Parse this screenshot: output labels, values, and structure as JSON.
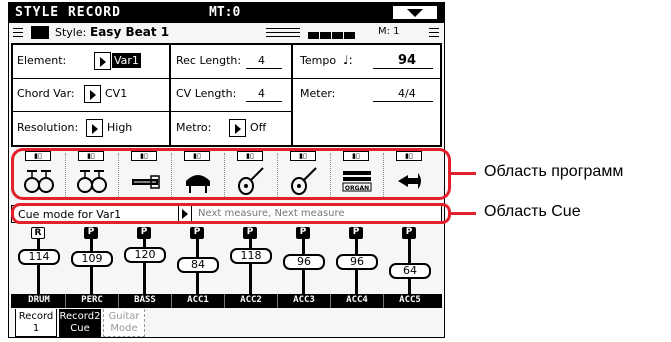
{
  "title": "STYLE RECORD",
  "mt": "MT:0",
  "style_bar": {
    "style_icon": "Style-icon",
    "style_label": "Style:",
    "style_name": "Easy Beat 1",
    "measure": "M: 1"
  },
  "params": {
    "element_label": "Element:",
    "element_value": "Var1",
    "chord_var_label": "Chord Var:",
    "chord_var_value": "CV1",
    "resolution_label": "Resolution:",
    "resolution_value": "High",
    "rec_length_label": "Rec Length:",
    "rec_length_value": "4",
    "cv_length_label": "CV Length:",
    "cv_length_value": "4",
    "metro_label": "Metro:",
    "metro_value": "Off",
    "tempo_label": "Tempo",
    "tempo_note": "♩:",
    "tempo_value": "94",
    "meter_label": "Meter:",
    "meter_value": "4/4"
  },
  "tracks": [
    {
      "icon": "drum-kit-icon"
    },
    {
      "icon": "drum-kit-icon"
    },
    {
      "icon": "bass-icon"
    },
    {
      "icon": "piano-icon"
    },
    {
      "icon": "guitar-icon"
    },
    {
      "icon": "guitar-icon"
    },
    {
      "icon": "organ-icon",
      "label": "ORGAN"
    },
    {
      "icon": "brass-icon"
    }
  ],
  "cue": {
    "label": "Cue mode for Var1",
    "value": "Next measure, Next measure"
  },
  "mixer": {
    "channels": [
      {
        "badge": "R",
        "value": "114",
        "name": "DRUM"
      },
      {
        "badge": "P",
        "value": "109",
        "name": "PERC"
      },
      {
        "badge": "P",
        "value": "120",
        "name": "BASS"
      },
      {
        "badge": "P",
        "value": "84",
        "name": "ACC1"
      },
      {
        "badge": "P",
        "value": "118",
        "name": "ACC2"
      },
      {
        "badge": "P",
        "value": "96",
        "name": "ACC3"
      },
      {
        "badge": "P",
        "value": "96",
        "name": "ACC4"
      },
      {
        "badge": "P",
        "value": "64",
        "name": "ACC5"
      }
    ]
  },
  "tabs": [
    {
      "line1": "Record",
      "line2": "1"
    },
    {
      "line1": "Record2",
      "line2": "Cue"
    },
    {
      "line1": "Guitar",
      "line2": "Mode"
    }
  ],
  "annotations": {
    "programs": "Область программ",
    "cue": "Область Cue",
    "color": "#e3202c"
  }
}
